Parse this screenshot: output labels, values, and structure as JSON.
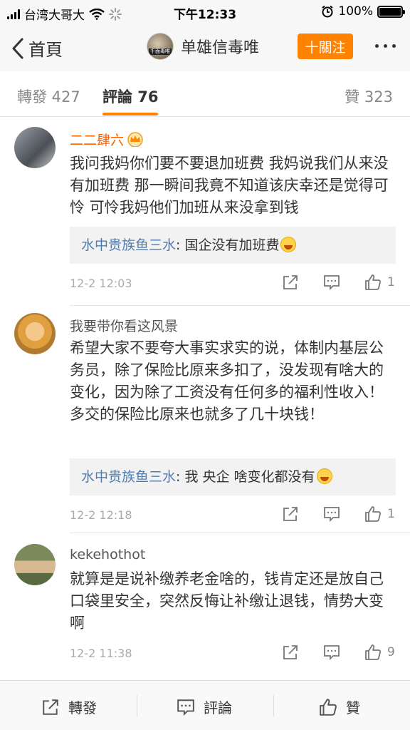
{
  "status": {
    "carrier": "台湾大哥大",
    "time": "下午12:33",
    "battery": "100%",
    "battery_level": 1.0
  },
  "nav": {
    "back_label": "首頁",
    "avatar_text": "千面毒唯",
    "title": "单雄信毒唯",
    "follow_label": "十關注"
  },
  "tabs": {
    "repost": "轉發 427",
    "comments": "評論 76",
    "likes": "贊 323"
  },
  "comments": [
    {
      "name": "二二肆六",
      "text": "我问我妈你们要不要退加班费 我妈说我们从来没有加班费 那一瞬间我竟不知道该庆幸还是觉得可怜 可怜我妈他们加班从来没拿到钱",
      "reply_name": "水中贵族鱼三水",
      "reply_text": ": 国企没有加班费",
      "time": "12-2 12:03",
      "likes": "1"
    },
    {
      "name": "我要带你看这风景",
      "text": "希望大家不要夸大事实求实的说，体制内基层公务员，除了保险比原来多扣了，没发现有啥大的变化，因为除了工资没有任何多的福利性收入！多交的保险比原来也就多了几十块钱！",
      "reply_name": "水中贵族鱼三水",
      "reply_text": ": 我 央企  啥变化都没有",
      "time": "12-2 12:18",
      "likes": "1"
    },
    {
      "name": "kekehothot",
      "text": "就算是是说补缴养老金啥的，钱肯定还是放自己口袋里安全，突然反悔让补缴让退钱，情势大变啊",
      "time": "12-2 11:38",
      "likes": "9"
    }
  ],
  "bottom": {
    "repost": "轉發",
    "comment": "評論",
    "like": "贊"
  },
  "colors": {
    "accent": "#ff8200",
    "vip_name": "#f86400",
    "reply_name": "#507daf"
  }
}
